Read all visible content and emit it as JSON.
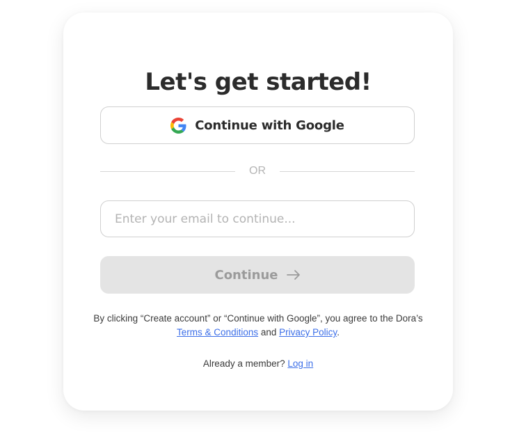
{
  "heading": "Let's get started!",
  "google_button": {
    "label": "Continue with Google",
    "icon": "google-g-icon"
  },
  "divider_text": "OR",
  "email": {
    "value": "",
    "placeholder": "Enter your email to continue..."
  },
  "continue_button": {
    "label": "Continue",
    "icon": "arrow-right-icon",
    "state": "disabled"
  },
  "legal": {
    "prefix": "By clicking “Create account” or “Continue with Google”, you agree to the Dora’s",
    "terms_link": "Terms & Conditions",
    "and_text": "and",
    "privacy_link": "Privacy Policy",
    "suffix": "."
  },
  "member": {
    "prompt": "Already a member?",
    "login_link": "Log in"
  },
  "colors": {
    "link": "#3b6ee8",
    "heading": "#2b2b2b",
    "disabled_button_bg": "#e4e4e4",
    "disabled_button_text": "#9b9b9b",
    "google_blue": "#4285F4",
    "google_red": "#EA4335",
    "google_yellow": "#FBBC05",
    "google_green": "#34A853"
  }
}
